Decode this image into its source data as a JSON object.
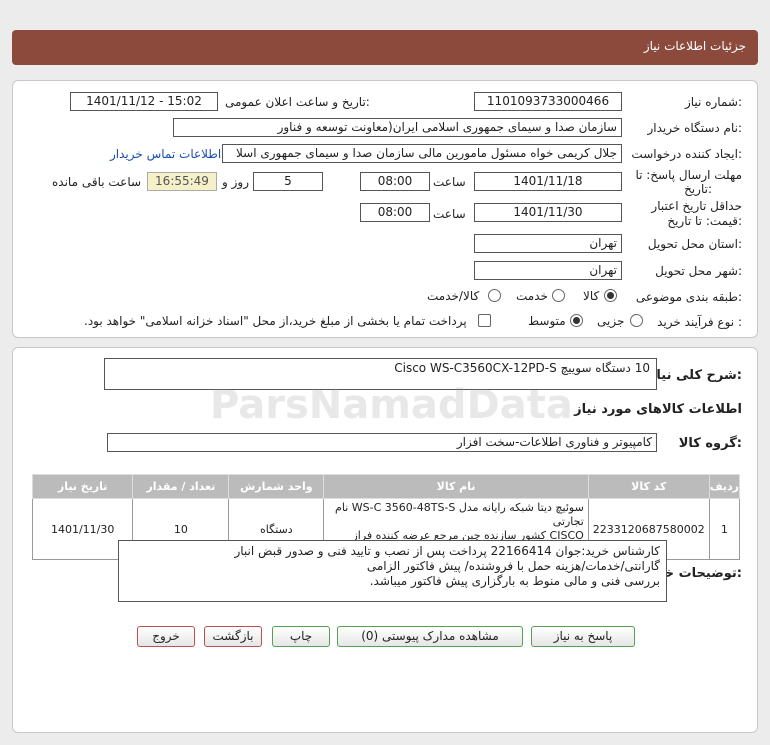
{
  "header": {
    "title": "جزئیات اطلاعات نیاز"
  },
  "form": {
    "need_number_label": "شماره نیاز:",
    "need_number": "1101093733000466",
    "announce_label": "تاریخ و ساعت اعلان عمومی:",
    "announce_value": "1401/11/12 - 15:02",
    "buyer_org_label": "نام دستگاه خریدار:",
    "buyer_org": "سازمان صدا و سیمای جمهوری اسلامی ایران(معاونت توسعه و فناور",
    "creator_label": "ایجاد کننده درخواست:",
    "creator": "جلال کریمی خواه مسئول مامورین مالی  سازمان صدا و سیمای جمهوری اسلا",
    "contact_link": "اطلاعات تماس خریدار",
    "deadline_label_1": "مهلت ارسال پاسخ: تا",
    "deadline_label_2": "تاریخ:",
    "deadline_date": "1401/11/18",
    "time_label": "ساعت",
    "deadline_time": "08:00",
    "days_value": "5",
    "days_label": "روز و",
    "remaining_time": "16:55:49",
    "remaining_label": "ساعت باقی مانده",
    "validity_label_1": "حداقل تاریخ اعتبار",
    "validity_label_2": "قیمت: تا تاریخ:",
    "validity_date": "1401/11/30",
    "validity_time_label": "ساعت",
    "validity_time": "08:00",
    "province_label": "استان محل تحویل:",
    "province": "تهران",
    "city_label": "شهر محل تحویل:",
    "city": "تهران",
    "category_label": "طبقه بندی موضوعی:",
    "category_options": [
      "کالا",
      "خدمت",
      "کالا/خدمت"
    ],
    "process_label": "نوع فرآیند خرید :",
    "process_options": [
      "جزیی",
      "متوسط"
    ],
    "payment_note": "پرداخت تمام یا بخشی از مبلغ خرید،از محل \"اسناد خزانه اسلامی\" خواهد بود."
  },
  "summary": {
    "label": "شرح کلی نیاز:",
    "value": "10 دستگاه سوییچ Cisco WS-C3560CX-12PD-S",
    "goods_info_title": "اطلاعات کالاهای مورد نیاز",
    "group_label": "گروه کالا:",
    "group_value": "کامپیوتر و فناوری اطلاعات-سخت افزار"
  },
  "table": {
    "headers": [
      "ردیف",
      "کد کالا",
      "نام کالا",
      "واحد شمارش",
      "تعداد / مقدار",
      "تاریخ نیاز"
    ],
    "rows": [
      {
        "row": "1",
        "code": "2233120687580002",
        "name_line1": "سوئیچ دیتا شبکه رایانه مدل WS-C 3560-48TS-S نام تجارتی",
        "name_line2": "CISCO کشور سازنده چین مرجع عرضه کننده فراز پرداز رایانه",
        "unit": "دستگاه",
        "qty": "10",
        "date": "1401/11/30"
      }
    ]
  },
  "buyer_notes": {
    "label": "توضیحات خریدار:",
    "line1": "کارشناس خرید:جوان 22166414    پرداخت پس از نصب و تایید فنی و صدور قبض انبار",
    "line2": "گارانتی/خدمات/هزینه حمل با فروشنده/ پیش فاکتور الزامی",
    "line3": "بررسی فنی و مالی منوط به بارگزاری پیش فاکتور میباشد."
  },
  "buttons": {
    "reply": "پاسخ به نیاز",
    "docs": "مشاهده مدارک پیوستی (0)",
    "print": "چاپ",
    "back": "بازگشت",
    "exit": "خروج"
  },
  "watermark": {
    "brand": "ParsNamadData"
  },
  "colors": {
    "header": "#8b4a3c",
    "link": "#1a4fb0"
  }
}
